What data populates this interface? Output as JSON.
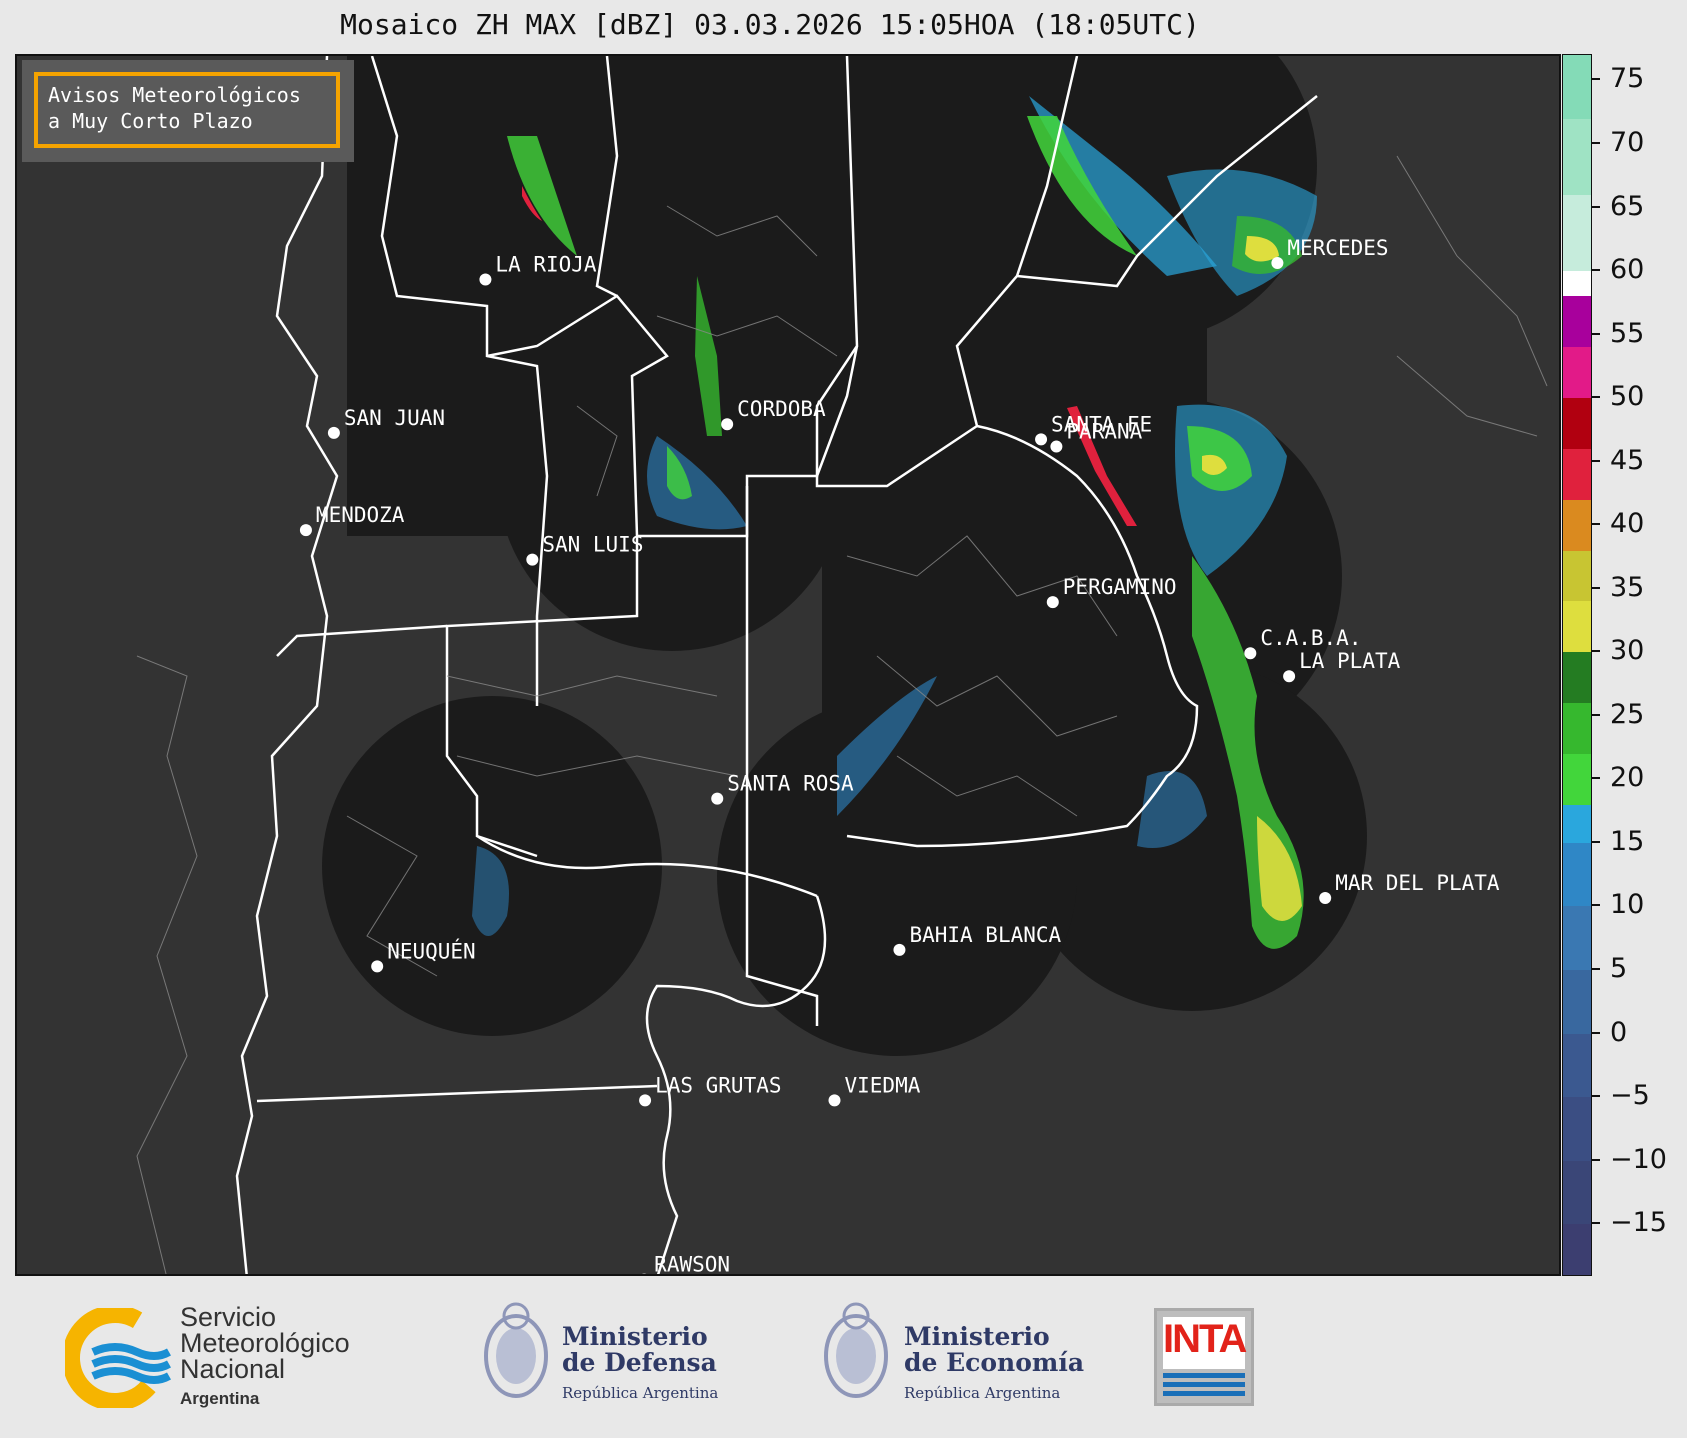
{
  "title": "Mosaico ZH MAX [dBZ] 03.03.2026 15:05HOA (18:05UTC)",
  "legend": {
    "line1": "Avisos Meteorológicos",
    "line2": "a Muy Corto Plazo",
    "border_color": "#f5a300"
  },
  "cities": [
    {
      "name": "LA RIOJA",
      "lon": -66.86,
      "lat": -29.41
    },
    {
      "name": "MERCEDES",
      "lon": -58.08,
      "lat": -29.18
    },
    {
      "name": "SAN JUAN",
      "lon": -68.54,
      "lat": -31.54
    },
    {
      "name": "CORDOBA",
      "lon": -64.18,
      "lat": -31.42
    },
    {
      "name": "SANTA FE",
      "lon": -60.7,
      "lat": -31.63
    },
    {
      "name": "PARANA",
      "lon": -60.53,
      "lat": -31.73
    },
    {
      "name": "MENDOZA",
      "lon": -68.85,
      "lat": -32.89
    },
    {
      "name": "SAN LUIS",
      "lon": -66.34,
      "lat": -33.3
    },
    {
      "name": "PERGAMINO",
      "lon": -60.57,
      "lat": -33.89
    },
    {
      "name": "C.A.B.A.",
      "lon": -58.38,
      "lat": -34.6
    },
    {
      "name": "LA PLATA",
      "lon": -57.95,
      "lat": -34.92
    },
    {
      "name": "SANTA ROSA",
      "lon": -64.29,
      "lat": -36.62
    },
    {
      "name": "MAR DEL PLATA",
      "lon": -57.55,
      "lat": -38.0
    },
    {
      "name": "BAHIA BLANCA",
      "lon": -62.27,
      "lat": -38.72
    },
    {
      "name": "NEUQUÉN",
      "lon": -68.06,
      "lat": -38.95
    },
    {
      "name": "LAS GRUTAS",
      "lon": -65.09,
      "lat": -40.81
    },
    {
      "name": "VIEDMA",
      "lon": -62.99,
      "lat": -40.81
    },
    {
      "name": "RAWSON",
      "lon": -65.1,
      "lat": -43.3
    }
  ],
  "colorbar": {
    "unit": "dBZ",
    "ticks": [
      "75",
      "70",
      "65",
      "60",
      "55",
      "50",
      "45",
      "40",
      "35",
      "30",
      "25",
      "20",
      "15",
      "10",
      "5",
      "0",
      "−5",
      "−10",
      "−15"
    ],
    "range": [
      -19,
      77
    ],
    "colors": [
      {
        "from": -19,
        "to": -15,
        "color": "#3c3e70"
      },
      {
        "from": -15,
        "to": -10,
        "color": "#3a4677"
      },
      {
        "from": -10,
        "to": -5,
        "color": "#3b4e83"
      },
      {
        "from": -5,
        "to": 0,
        "color": "#3b5990"
      },
      {
        "from": 0,
        "to": 5,
        "color": "#39689f"
      },
      {
        "from": 5,
        "to": 10,
        "color": "#3a78b2"
      },
      {
        "from": 10,
        "to": 15,
        "color": "#2f87c6"
      },
      {
        "from": 15,
        "to": 18,
        "color": "#2aa7dd"
      },
      {
        "from": 18,
        "to": 22,
        "color": "#42d63b"
      },
      {
        "from": 22,
        "to": 26,
        "color": "#36b82e"
      },
      {
        "from": 26,
        "to": 30,
        "color": "#247c22"
      },
      {
        "from": 30,
        "to": 34,
        "color": "#dede3e"
      },
      {
        "from": 34,
        "to": 38,
        "color": "#c8c532"
      },
      {
        "from": 38,
        "to": 42,
        "color": "#da8a1f"
      },
      {
        "from": 42,
        "to": 46,
        "color": "#e0213d"
      },
      {
        "from": 46,
        "to": 50,
        "color": "#b10010"
      },
      {
        "from": 50,
        "to": 54,
        "color": "#e21a88"
      },
      {
        "from": 54,
        "to": 58,
        "color": "#a8009c"
      },
      {
        "from": 58,
        "to": 60,
        "color": "#ffffff"
      },
      {
        "from": 60,
        "to": 66,
        "color": "#c6ecdc"
      },
      {
        "from": 66,
        "to": 72,
        "color": "#9fe3c4"
      },
      {
        "from": 72,
        "to": 77,
        "color": "#84dbb7"
      }
    ]
  },
  "footer": {
    "smn": {
      "line1": "Servicio",
      "line2": "Meteorológico",
      "line3": "Nacional",
      "line4": "Argentina"
    },
    "defensa": {
      "line1": "Ministerio",
      "line2": "de Defensa",
      "line3": "República Argentina"
    },
    "economia": {
      "line1": "Ministerio",
      "line2": "de Economía",
      "line3": "República Argentina"
    },
    "inta": "INTA"
  }
}
